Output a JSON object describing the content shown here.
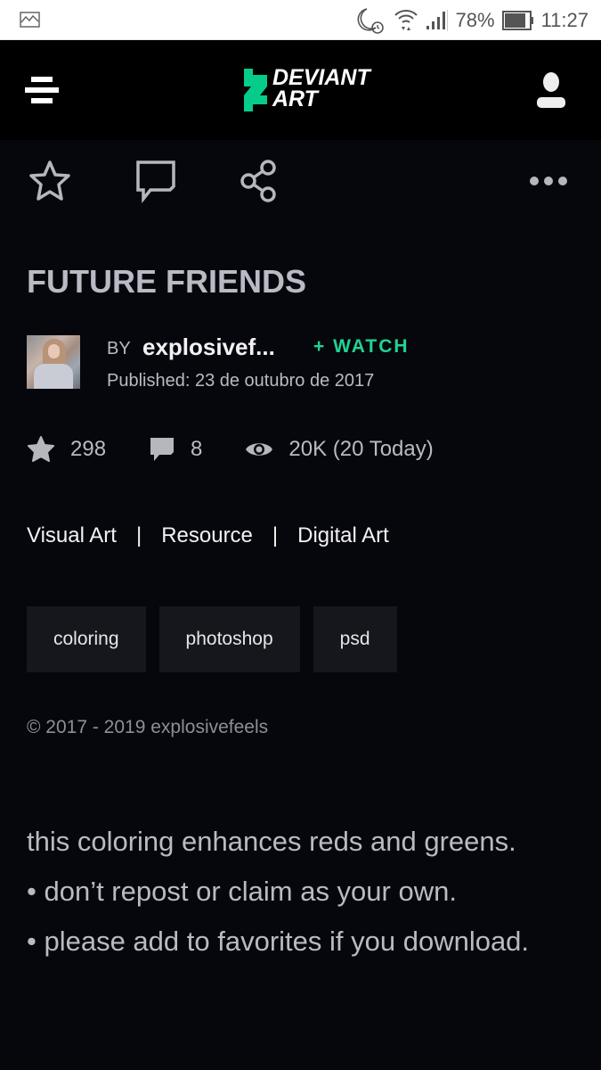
{
  "status_bar": {
    "battery_percent": "78%",
    "time": "11:27",
    "icons": [
      "gallery-icon",
      "do-not-disturb-icon",
      "alarm-icon",
      "wifi-icon",
      "signal-icon",
      "battery-icon"
    ]
  },
  "nav": {
    "menu_icon": "hamburger-icon",
    "logo_line1": "DEVIANT",
    "logo_line2": "ART",
    "user_icon": "user-icon",
    "brand_color": "#05cc47"
  },
  "actions": {
    "favorite_icon": "star-outline-icon",
    "comment_icon": "comment-icon",
    "share_icon": "share-icon",
    "more_icon": "more-horizontal-icon"
  },
  "deviation": {
    "title": "FUTURE FRIENDS",
    "by_label": "BY",
    "author": "explosivef...",
    "watch_label": "+ WATCH",
    "published": "Published: 23 de outubro de 2017",
    "stats": {
      "favorites": "298",
      "comments": "8",
      "views": "20K (20 Today)"
    },
    "categories": [
      "Visual Art",
      "Resource",
      "Digital Art"
    ],
    "category_separator": "|",
    "tags": [
      "coloring",
      "photoshop",
      "psd"
    ],
    "copyright": "© 2017 - 2019 explosivefeels",
    "description": [
      "this coloring enhances reds and greens.",
      "• don’t repost or claim as your own.",
      "• please add to favorites if you download."
    ]
  },
  "colors": {
    "accent_green": "#1ed493",
    "background": "#06070d",
    "tag_background": "#15171c"
  }
}
